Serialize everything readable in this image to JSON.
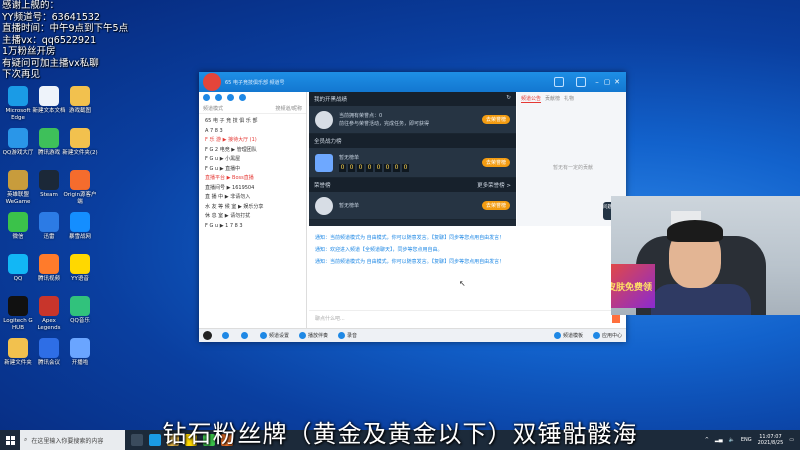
{
  "overlay": {
    "lines": [
      "感谢上舰的：",
      "YY频道号：63641532",
      "直播时间：中午9点到下午5点",
      "主播vx：qq6522921",
      "1万粉丝开房",
      "有疑问可加主播vx私聊",
      "下次再见"
    ]
  },
  "desktop": {
    "icons": [
      {
        "label": "Microsoft Edge",
        "color": "#1a9be6"
      },
      {
        "label": "新建文本文档",
        "color": "#eef3fa"
      },
      {
        "label": "游戏截图",
        "color": "#f2c14e"
      },
      {
        "label": "QQ游戏大厅",
        "color": "#2a96e8"
      },
      {
        "label": "腾讯游戏",
        "color": "#3ec05a"
      },
      {
        "label": "新建文件夹(2)",
        "color": "#f2c14e"
      },
      {
        "label": "英雄联盟WeGame",
        "color": "#c89c3c"
      },
      {
        "label": "Steam",
        "color": "#1b2838"
      },
      {
        "label": "Origin源客户端",
        "color": "#f56c2d"
      },
      {
        "label": "微信",
        "color": "#3bc24a"
      },
      {
        "label": "迅雷",
        "color": "#2c7be5"
      },
      {
        "label": "暴雪战网",
        "color": "#148eff"
      },
      {
        "label": "QQ",
        "color": "#12b7f5"
      },
      {
        "label": "腾讯视频",
        "color": "#ff7b2b"
      },
      {
        "label": "YY语音",
        "color": "#ffd800"
      },
      {
        "label": "Logitech G HUB",
        "color": "#111111"
      },
      {
        "label": "Apex Legends",
        "color": "#c8352b"
      },
      {
        "label": "QQ音乐",
        "color": "#31c27c"
      },
      {
        "label": "新建文件夹",
        "color": "#f2c14e"
      },
      {
        "label": "腾讯会议",
        "color": "#2e6ee6"
      },
      {
        "label": "开播啦",
        "color": "#6aa5ff"
      }
    ]
  },
  "app": {
    "title": "65 电子竞技俱乐部  频道号",
    "search_placeholder": "搜频道/昵称",
    "left_header": "频道模式",
    "channel_lines": [
      "65 电 子 竞 技 俱 乐 部",
      "A 7 8 3",
      "F 乐 游 ▶ 接待大厅 (1)",
      "F G 2 电竞 ▶ 管理团队",
      "F G u ▶ 小黑屋",
      "F G u ▶ 直播中",
      "直播平台 ▶ Boss直播",
      "直播间号 ▶ 1619504",
      "直 播 中 ▶ 非请勿入",
      "水 友 等 候 室 ▶ 娱乐分享",
      "休 息 室 ▶ 请勿打扰",
      "F G u ▶ 1 7 8 3"
    ],
    "section1": {
      "title": "我的开黑战绩",
      "row_text_1": "当前拥有荣誉点：0",
      "row_text_2": "前往参与荣誉活动，完成任务，即可获得",
      "btn": "去荣誉榜"
    },
    "section2": {
      "title": "全员战力榜",
      "row_text": "暂无榜单",
      "digits": [
        "0",
        "0",
        "0",
        "0",
        "0",
        "0",
        "0",
        "0"
      ],
      "btn": "去荣誉榜"
    },
    "section3": {
      "title": "荣誉榜",
      "more": "更多荣誉榜 >",
      "row_text": "暂无榜单",
      "btn": "去荣誉榜"
    },
    "right": {
      "tab_active": "频道公告",
      "tab2": "贡献榜",
      "tab3": "礼物",
      "empty": "暂无有一定的贡献",
      "open_btn": "问题反馈"
    },
    "chat": {
      "lines": [
        "通知：当前频道模式为 自由模式，你可以随意发言。【复聊】同步等您点用自由发言！",
        "通知：欢迎进入频道【全频道聊天】，同步等您点用自由。",
        "通知：当前频道模式为 自由模式，你可以随意发言。【复聊】同步等您点用自由发言！"
      ],
      "input_placeholder": "聊点什么吧..."
    },
    "bottom": {
      "item1": "频道设置",
      "item2": "播放伴奏",
      "item3": "录音",
      "item4": "频道模板",
      "item5": "应用中心"
    }
  },
  "webcam": {
    "poster_text": "皮肤免费领"
  },
  "subtitle": "钻石粉丝牌（黄金及黄金以下）双锤骷髅海",
  "taskbar": {
    "search_placeholder": "在这里输入你要搜索的内容",
    "lang": "ENG",
    "time": "11:07:07",
    "date": "2021/8/25"
  }
}
